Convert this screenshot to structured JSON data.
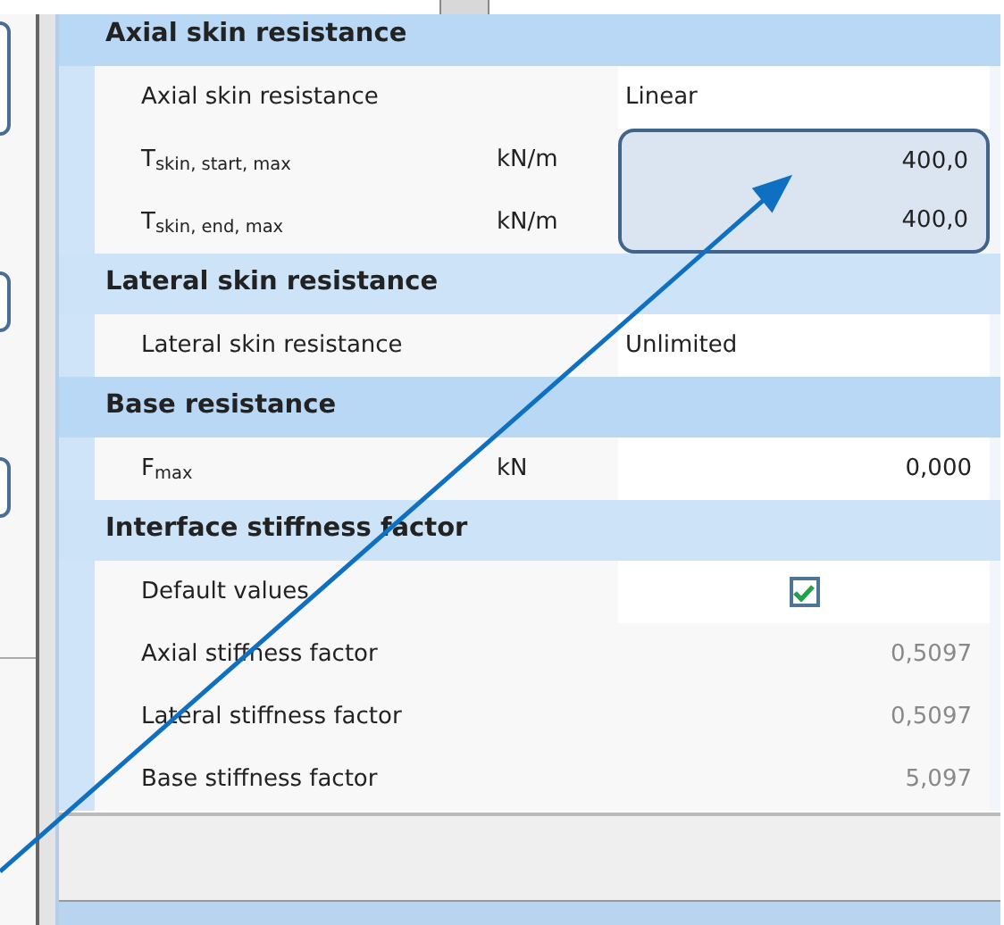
{
  "sections": [
    {
      "title": "Axial skin resistance",
      "rows": [
        {
          "label": "Axial skin resistance",
          "unit": "",
          "value": "Linear",
          "kind": "text",
          "disabled": false,
          "highlighted": false
        },
        {
          "label": "T$_{skin, start, max}$",
          "unit": "kN/m",
          "value": "400,0",
          "kind": "number",
          "disabled": false,
          "highlighted": true
        },
        {
          "label": "T$_{skin, end, max}$",
          "unit": "kN/m",
          "value": "400,0",
          "kind": "number",
          "disabled": false,
          "highlighted": true
        }
      ]
    },
    {
      "title": "Lateral skin resistance",
      "rows": [
        {
          "label": "Lateral skin resistance",
          "unit": "",
          "value": "Unlimited",
          "kind": "text",
          "disabled": false,
          "highlighted": false
        }
      ]
    },
    {
      "title": "Base resistance",
      "rows": [
        {
          "label": "F$_{max}$",
          "unit": "kN",
          "value": "0,000",
          "kind": "number",
          "disabled": false,
          "highlighted": false
        }
      ]
    },
    {
      "title": "Interface stiffness factor",
      "rows": [
        {
          "label": "Default values",
          "unit": "",
          "kind": "checkbox",
          "checked": true,
          "disabled": false,
          "highlighted": false
        },
        {
          "label": "Axial stiffness factor",
          "unit": "",
          "value": "0,5097",
          "kind": "number",
          "disabled": true,
          "highlighted": false
        },
        {
          "label": "Lateral stiffness factor",
          "unit": "",
          "value": "0,5097",
          "kind": "number",
          "disabled": true,
          "highlighted": false
        },
        {
          "label": "Base stiffness factor",
          "unit": "",
          "value": "5,097",
          "kind": "number",
          "disabled": true,
          "highlighted": false
        }
      ]
    }
  ]
}
